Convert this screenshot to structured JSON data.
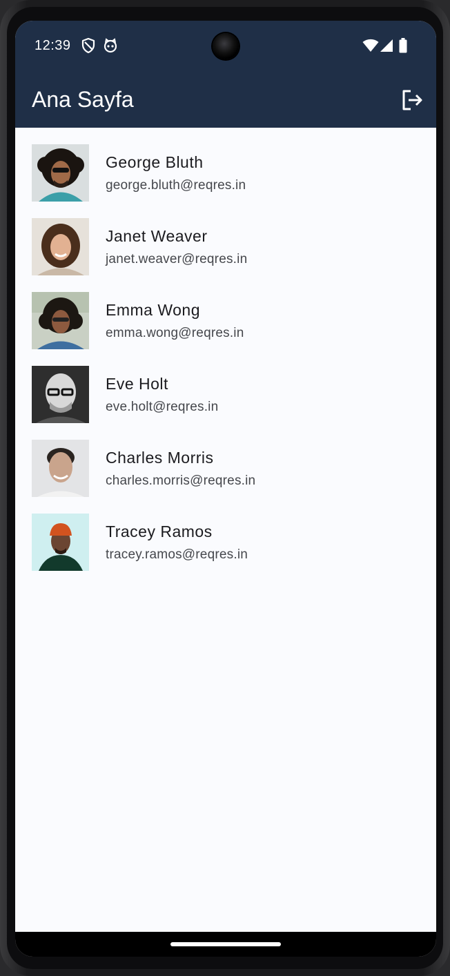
{
  "status_bar": {
    "time": "12:39",
    "left_icons": [
      "shield-icon",
      "cat-face-icon"
    ],
    "right_icons": [
      "wifi-icon",
      "signal-icon",
      "battery-icon"
    ],
    "background": "#1f2f47"
  },
  "app_bar": {
    "title": "Ana Sayfa",
    "action_icon": "logout-icon",
    "background": "#1f2f47"
  },
  "users": [
    {
      "name": "George Bluth",
      "email": "george.bluth@reqres.in"
    },
    {
      "name": "Janet Weaver",
      "email": "janet.weaver@reqres.in"
    },
    {
      "name": "Emma Wong",
      "email": "emma.wong@reqres.in"
    },
    {
      "name": "Eve Holt",
      "email": "eve.holt@reqres.in"
    },
    {
      "name": "Charles Morris",
      "email": "charles.morris@reqres.in"
    },
    {
      "name": "Tracey Ramos",
      "email": "tracey.ramos@reqres.in"
    }
  ],
  "colors": {
    "accent": "#1f2f47",
    "page_background": "#fafbfe",
    "name_text": "#1b1b1f",
    "email_text": "#45474c"
  }
}
